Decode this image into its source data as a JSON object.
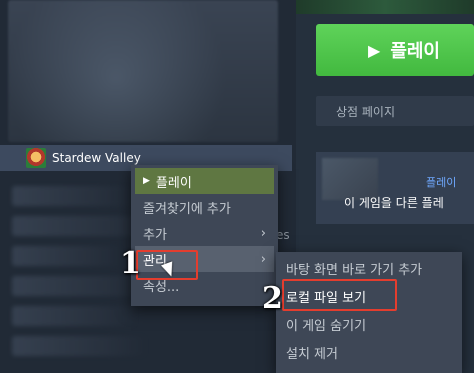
{
  "library": {
    "selected_game": "Stardew Valley"
  },
  "details": {
    "play_button_label": "플레이",
    "store_page_label": "상점 페이지",
    "friends_link": "플레이",
    "friends_desc": "이 게임을 다른 플레",
    "partial_text": "es"
  },
  "context_menu": {
    "items": [
      {
        "label": "플레이"
      },
      {
        "label": "즐겨찾기에 추가"
      },
      {
        "label": "추가"
      },
      {
        "label": "관리"
      },
      {
        "label": "속성..."
      }
    ]
  },
  "manage_submenu": {
    "items": [
      {
        "label": "바탕 화면 바로 가기 추가"
      },
      {
        "label": "로컬 파일 보기"
      },
      {
        "label": "이 게임 숨기기"
      },
      {
        "label": "설치 제거"
      }
    ]
  },
  "annotations": {
    "step1": "1",
    "step2": "2"
  },
  "colors": {
    "play_green": "#5fd35a",
    "callout_red": "#e43d2e",
    "menu_bg": "#3e4756"
  }
}
